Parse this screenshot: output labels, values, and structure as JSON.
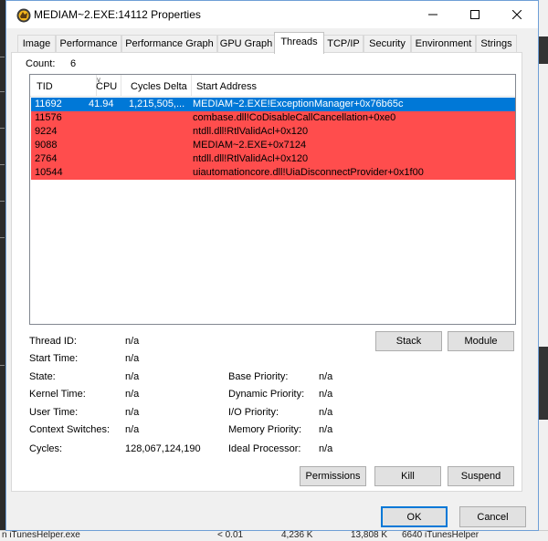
{
  "window": {
    "title": "MEDIAM~2.EXE:14112 Properties"
  },
  "tabs": [
    {
      "label": "Image",
      "active": false
    },
    {
      "label": "Performance",
      "active": false
    },
    {
      "label": "Performance Graph",
      "active": false
    },
    {
      "label": "GPU Graph",
      "active": false
    },
    {
      "label": "Threads",
      "active": true
    },
    {
      "label": "TCP/IP",
      "active": false
    },
    {
      "label": "Security",
      "active": false
    },
    {
      "label": "Environment",
      "active": false
    },
    {
      "label": "Strings",
      "active": false
    }
  ],
  "threads": {
    "count_label": "Count:",
    "count_value": "6",
    "columns": [
      "TID",
      "CPU",
      "Cycles Delta",
      "Start Address"
    ],
    "rows": [
      {
        "tid": "11692",
        "cpu": "41.94",
        "cycles": "1,215,505,...",
        "start": "MEDIAM~2.EXE!ExceptionManager+0x76b65c",
        "state": "selected"
      },
      {
        "tid": "11576",
        "cpu": "",
        "cycles": "",
        "start": "combase.dll!CoDisableCallCancellation+0xe0",
        "state": "red"
      },
      {
        "tid": "9224",
        "cpu": "",
        "cycles": "",
        "start": "ntdll.dll!RtlValidAcl+0x120",
        "state": "red"
      },
      {
        "tid": "9088",
        "cpu": "",
        "cycles": "",
        "start": "MEDIAM~2.EXE+0x7124",
        "state": "red"
      },
      {
        "tid": "2764",
        "cpu": "",
        "cycles": "",
        "start": "ntdll.dll!RtlValidAcl+0x120",
        "state": "red"
      },
      {
        "tid": "10544",
        "cpu": "",
        "cycles": "",
        "start": "uiautomationcore.dll!UiaDisconnectProvider+0x1f00",
        "state": "red"
      }
    ]
  },
  "details": {
    "thread_id_label": "Thread ID:",
    "thread_id": "n/a",
    "start_time_label": "Start Time:",
    "start_time": "n/a",
    "state_label": "State:",
    "state": "n/a",
    "kernel_time_label": "Kernel Time:",
    "kernel_time": "n/a",
    "user_time_label": "User Time:",
    "user_time": "n/a",
    "context_switches_label": "Context Switches:",
    "context_switches": "n/a",
    "cycles_label": "Cycles:",
    "cycles": "128,067,124,190",
    "base_priority_label": "Base Priority:",
    "base_priority": "n/a",
    "dynamic_priority_label": "Dynamic Priority:",
    "dynamic_priority": "n/a",
    "io_priority_label": "I/O Priority:",
    "io_priority": "n/a",
    "memory_priority_label": "Memory Priority:",
    "memory_priority": "n/a",
    "ideal_processor_label": "Ideal Processor:",
    "ideal_processor": "n/a"
  },
  "buttons": {
    "stack": "Stack",
    "module": "Module",
    "permissions": "Permissions",
    "kill": "Kill",
    "suspend": "Suspend",
    "ok": "OK",
    "cancel": "Cancel"
  },
  "background": {
    "left_label": "n iTunesHelper.exe",
    "cpu": "< 0.01",
    "private": "4,236 K",
    "working": "13,808 K",
    "pid_desc": "6640 iTunesHelper"
  },
  "colors": {
    "selected_row": "#0078d7",
    "highlight_row": "#ff4d4d",
    "window_border": "#6f9fd6"
  }
}
